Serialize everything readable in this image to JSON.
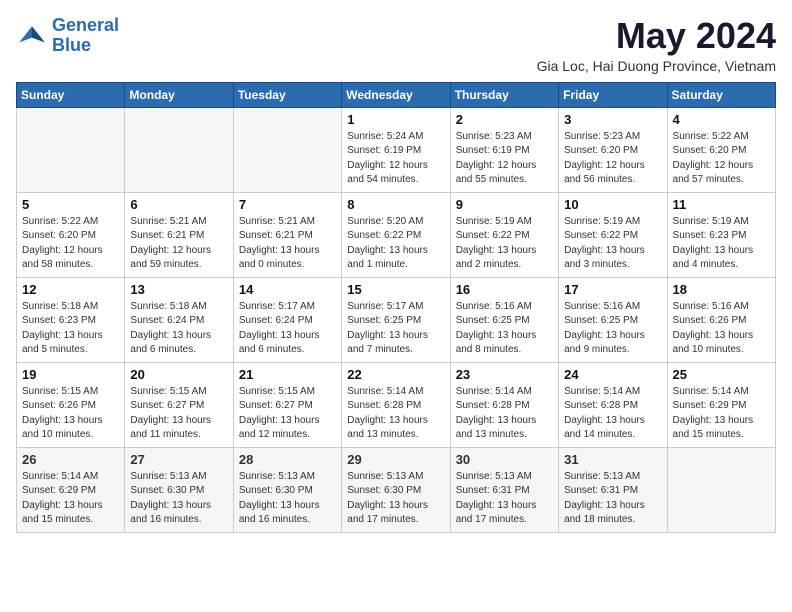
{
  "logo": {
    "line1": "General",
    "line2": "Blue"
  },
  "title": "May 2024",
  "subtitle": "Gia Loc, Hai Duong Province, Vietnam",
  "headers": [
    "Sunday",
    "Monday",
    "Tuesday",
    "Wednesday",
    "Thursday",
    "Friday",
    "Saturday"
  ],
  "weeks": [
    [
      {
        "num": "",
        "info": ""
      },
      {
        "num": "",
        "info": ""
      },
      {
        "num": "",
        "info": ""
      },
      {
        "num": "1",
        "info": "Sunrise: 5:24 AM\nSunset: 6:19 PM\nDaylight: 12 hours\nand 54 minutes."
      },
      {
        "num": "2",
        "info": "Sunrise: 5:23 AM\nSunset: 6:19 PM\nDaylight: 12 hours\nand 55 minutes."
      },
      {
        "num": "3",
        "info": "Sunrise: 5:23 AM\nSunset: 6:20 PM\nDaylight: 12 hours\nand 56 minutes."
      },
      {
        "num": "4",
        "info": "Sunrise: 5:22 AM\nSunset: 6:20 PM\nDaylight: 12 hours\nand 57 minutes."
      }
    ],
    [
      {
        "num": "5",
        "info": "Sunrise: 5:22 AM\nSunset: 6:20 PM\nDaylight: 12 hours\nand 58 minutes."
      },
      {
        "num": "6",
        "info": "Sunrise: 5:21 AM\nSunset: 6:21 PM\nDaylight: 12 hours\nand 59 minutes."
      },
      {
        "num": "7",
        "info": "Sunrise: 5:21 AM\nSunset: 6:21 PM\nDaylight: 13 hours\nand 0 minutes."
      },
      {
        "num": "8",
        "info": "Sunrise: 5:20 AM\nSunset: 6:22 PM\nDaylight: 13 hours\nand 1 minute."
      },
      {
        "num": "9",
        "info": "Sunrise: 5:19 AM\nSunset: 6:22 PM\nDaylight: 13 hours\nand 2 minutes."
      },
      {
        "num": "10",
        "info": "Sunrise: 5:19 AM\nSunset: 6:22 PM\nDaylight: 13 hours\nand 3 minutes."
      },
      {
        "num": "11",
        "info": "Sunrise: 5:19 AM\nSunset: 6:23 PM\nDaylight: 13 hours\nand 4 minutes."
      }
    ],
    [
      {
        "num": "12",
        "info": "Sunrise: 5:18 AM\nSunset: 6:23 PM\nDaylight: 13 hours\nand 5 minutes."
      },
      {
        "num": "13",
        "info": "Sunrise: 5:18 AM\nSunset: 6:24 PM\nDaylight: 13 hours\nand 6 minutes."
      },
      {
        "num": "14",
        "info": "Sunrise: 5:17 AM\nSunset: 6:24 PM\nDaylight: 13 hours\nand 6 minutes."
      },
      {
        "num": "15",
        "info": "Sunrise: 5:17 AM\nSunset: 6:25 PM\nDaylight: 13 hours\nand 7 minutes."
      },
      {
        "num": "16",
        "info": "Sunrise: 5:16 AM\nSunset: 6:25 PM\nDaylight: 13 hours\nand 8 minutes."
      },
      {
        "num": "17",
        "info": "Sunrise: 5:16 AM\nSunset: 6:25 PM\nDaylight: 13 hours\nand 9 minutes."
      },
      {
        "num": "18",
        "info": "Sunrise: 5:16 AM\nSunset: 6:26 PM\nDaylight: 13 hours\nand 10 minutes."
      }
    ],
    [
      {
        "num": "19",
        "info": "Sunrise: 5:15 AM\nSunset: 6:26 PM\nDaylight: 13 hours\nand 10 minutes."
      },
      {
        "num": "20",
        "info": "Sunrise: 5:15 AM\nSunset: 6:27 PM\nDaylight: 13 hours\nand 11 minutes."
      },
      {
        "num": "21",
        "info": "Sunrise: 5:15 AM\nSunset: 6:27 PM\nDaylight: 13 hours\nand 12 minutes."
      },
      {
        "num": "22",
        "info": "Sunrise: 5:14 AM\nSunset: 6:28 PM\nDaylight: 13 hours\nand 13 minutes."
      },
      {
        "num": "23",
        "info": "Sunrise: 5:14 AM\nSunset: 6:28 PM\nDaylight: 13 hours\nand 13 minutes."
      },
      {
        "num": "24",
        "info": "Sunrise: 5:14 AM\nSunset: 6:28 PM\nDaylight: 13 hours\nand 14 minutes."
      },
      {
        "num": "25",
        "info": "Sunrise: 5:14 AM\nSunset: 6:29 PM\nDaylight: 13 hours\nand 15 minutes."
      }
    ],
    [
      {
        "num": "26",
        "info": "Sunrise: 5:14 AM\nSunset: 6:29 PM\nDaylight: 13 hours\nand 15 minutes."
      },
      {
        "num": "27",
        "info": "Sunrise: 5:13 AM\nSunset: 6:30 PM\nDaylight: 13 hours\nand 16 minutes."
      },
      {
        "num": "28",
        "info": "Sunrise: 5:13 AM\nSunset: 6:30 PM\nDaylight: 13 hours\nand 16 minutes."
      },
      {
        "num": "29",
        "info": "Sunrise: 5:13 AM\nSunset: 6:30 PM\nDaylight: 13 hours\nand 17 minutes."
      },
      {
        "num": "30",
        "info": "Sunrise: 5:13 AM\nSunset: 6:31 PM\nDaylight: 13 hours\nand 17 minutes."
      },
      {
        "num": "31",
        "info": "Sunrise: 5:13 AM\nSunset: 6:31 PM\nDaylight: 13 hours\nand 18 minutes."
      },
      {
        "num": "",
        "info": ""
      }
    ]
  ]
}
